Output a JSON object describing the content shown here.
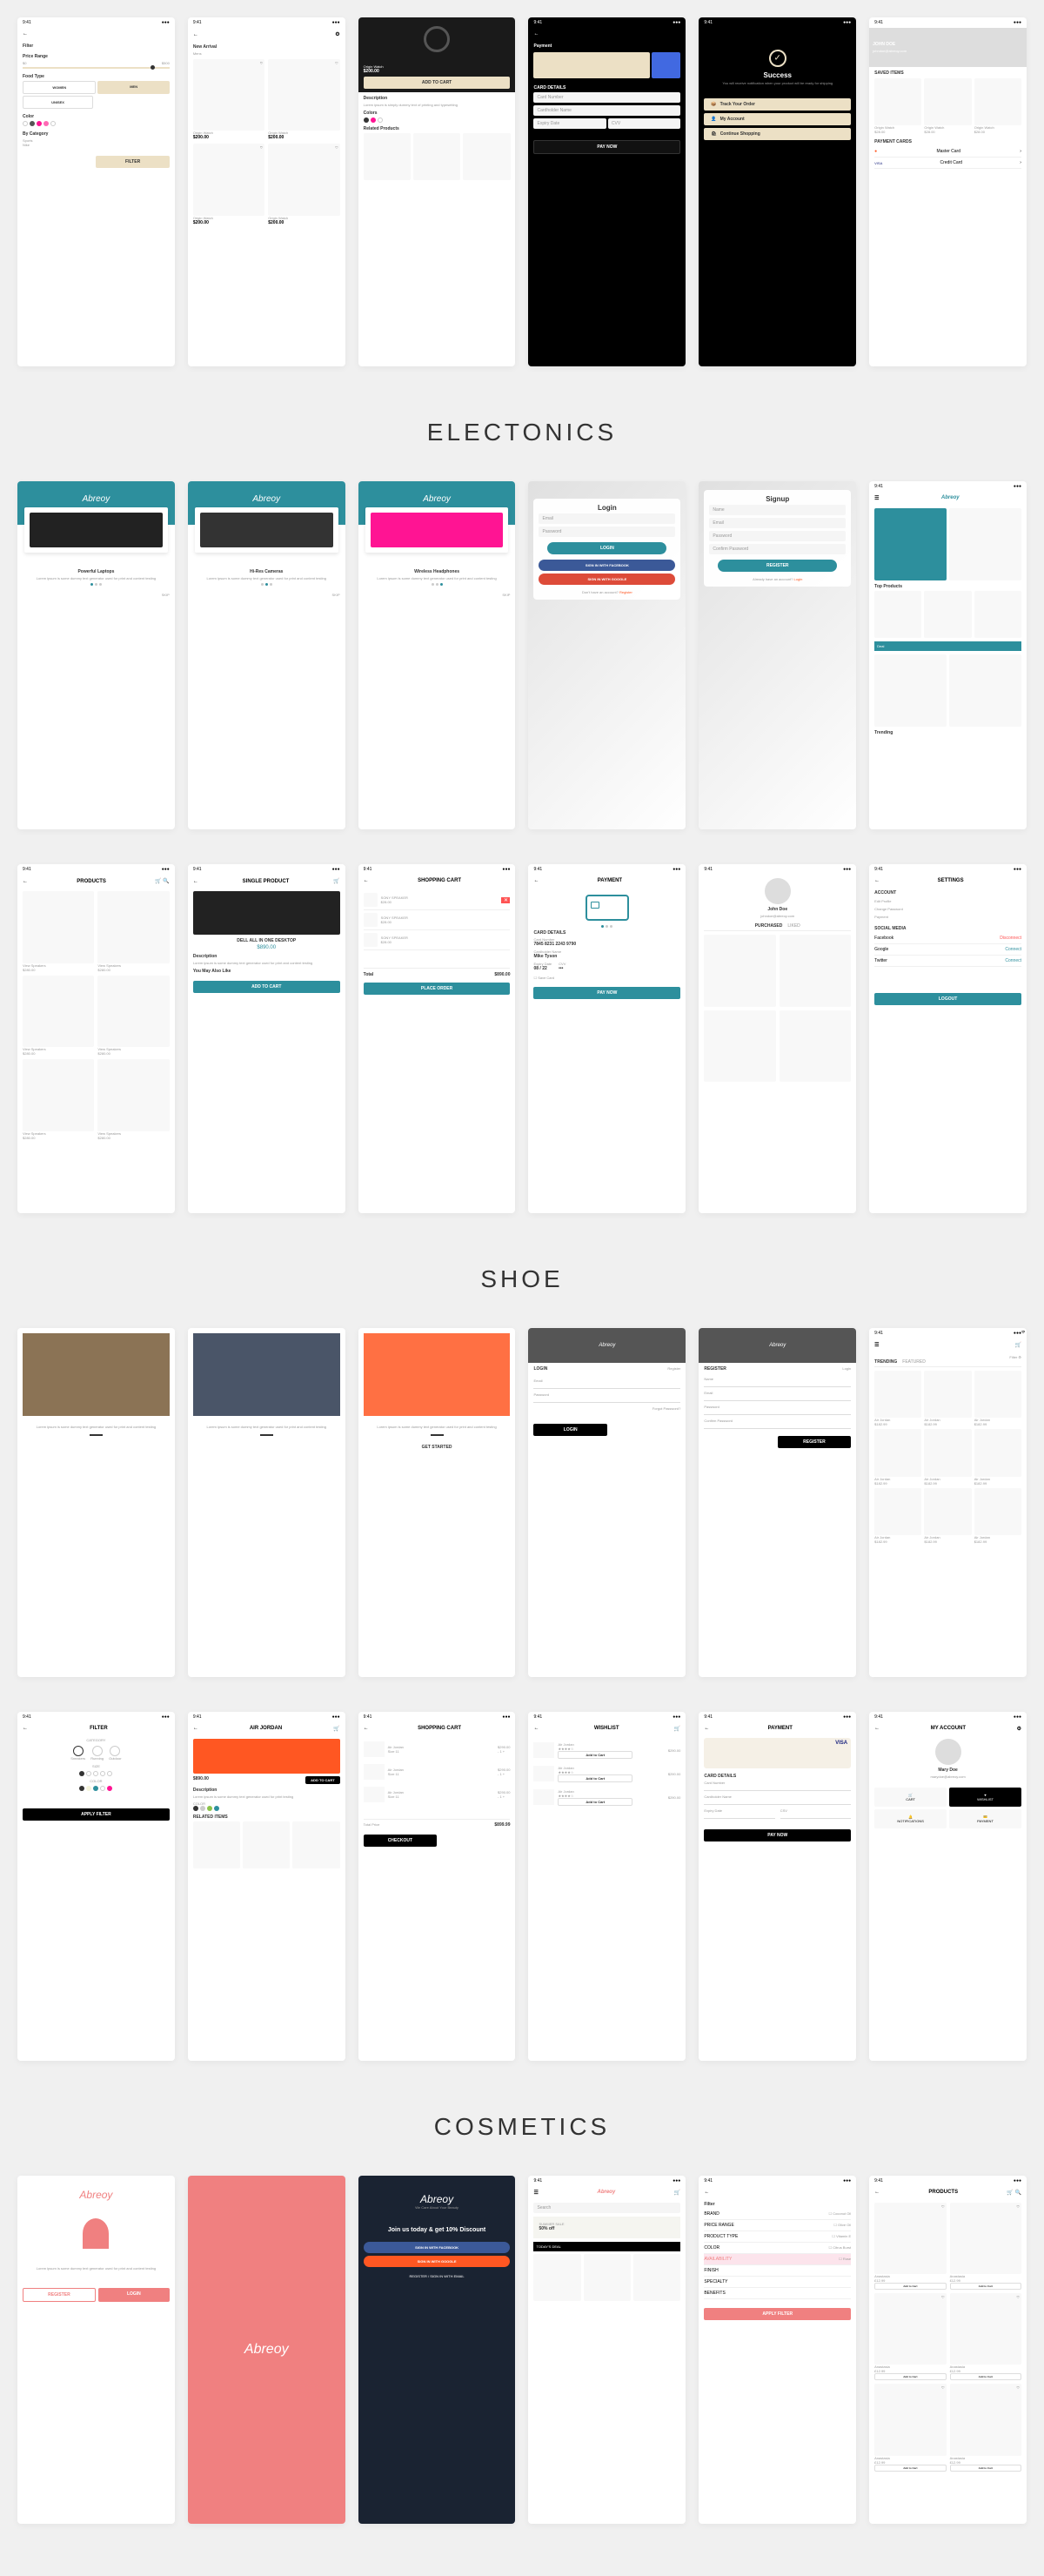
{
  "sections": {
    "electronics": "ELECTONICS",
    "shoe": "SHOE",
    "cosmetics": "COSMETICS"
  },
  "brand": "Abreoy",
  "status_time": "9:41",
  "watch": {
    "filter_title": "Filter",
    "price_range_label": "Price Range",
    "price_min": "$0",
    "price_max": "$500",
    "food_type_label": "Food Type",
    "food_types": [
      "WOMEN",
      "MEN",
      "UNISEX"
    ],
    "color_label": "Color",
    "category_label": "By Category",
    "category_options": [
      "Sports",
      "Nike"
    ],
    "filter_btn": "FILTER",
    "new_arrival": "New Arrival",
    "mens_tab": "Mens",
    "product_name": "Origin Watch",
    "product_price": "$200.00",
    "add_to_cart": "ADD TO CART",
    "description_label": "Description",
    "description_text": "Lorem ipsum is simply dummy text of printing and typesetting",
    "colors_label": "Colors",
    "related_label": "Related Products",
    "payment_title": "Payment",
    "card_details": "CARD DETAILS",
    "card_number": "Card Number",
    "cardholder": "Cardholder Name",
    "expiry": "Expiry Date",
    "cvv": "CVV",
    "pay_now": "PAY NOW",
    "success_title": "Success",
    "success_msg": "You will receive notification when your product will be ready for shipping",
    "track_order": "Track Your Order",
    "my_account": "My Account",
    "continue_shopping": "Continue Shopping",
    "profile_name": "JOHN DOE",
    "profile_email": "johndoe@abreoy.com",
    "saved_items": "SAVED ITEMS",
    "payment_cards": "PAYMENT CARDS",
    "mastercard": "Master Card",
    "credit_card": "Credit Card",
    "watch_price_sm": "$28.00"
  },
  "electronics": {
    "onboard_titles": [
      "Powerful Laptops",
      "Hi-Res Cameras",
      "Wireless Headphones"
    ],
    "onboard_desc": "Lorem ipsum is some dummy text generator used for print and content testing",
    "skip": "SKIP",
    "login": "Login",
    "signup": "Signup",
    "email": "Email",
    "password": "Password",
    "name": "Name",
    "confirm_password": "Confirm Password",
    "login_btn": "LOGIN",
    "register_btn": "REGISTER",
    "fb_btn": "SIGN IN WITH FACEBOOK",
    "google_btn": "SIGN IN WITH GOOGLE",
    "no_account": "Don't have an account?",
    "already_account": "Already have an account?",
    "register_link": "Register",
    "login_link": "Login",
    "top_products": "Top Products",
    "trending": "Trending",
    "products_title": "PRODUCTS",
    "single_product": "SINGLE PRODUCT",
    "dell_name": "DELL ALL IN ONE DESKTOP",
    "dell_price": "$890.00",
    "may_also_like": "You May Also Like",
    "shopping_cart": "SHOPPING CART",
    "cart_item": "SONY SPEAKER",
    "cart_price": "$28.00",
    "total": "Total",
    "total_price": "$890.00",
    "place_order": "PLACE ORDER",
    "payment_title": "PAYMENT",
    "card_num_val": "7845 8231 2243 9790",
    "cardholder_val": "Mike Tyson",
    "expiry_val": "08 / 22",
    "save_card": "Save Card",
    "pay_now": "PAY NOW",
    "profile_name": "John Doe",
    "profile_email": "johndoe@abreoy.com",
    "purchased": "PURCHASED",
    "liked": "LIKED",
    "settings": "SETTINGS",
    "account": "ACCOUNT",
    "edit_profile": "Edit Profile",
    "change_password": "Change Password",
    "payment_opt": "Payment",
    "social_media": "SOCIAL MEDIA",
    "facebook": "Facebook",
    "google": "Google",
    "twitter": "Twitter",
    "disconnect": "Disconnect",
    "connect": "Connect",
    "logout": "LOGOUT",
    "prod_label": "View Speakers",
    "prod_price": "$280.00"
  },
  "shoe": {
    "onboard_desc": "Lorem ipsum is some dummy text generator used for print and content testing",
    "get_started": "GET STARTED",
    "login": "LOGIN",
    "register": "REGISTER",
    "register_link": "Register",
    "login_link": "Login",
    "email": "Email",
    "password": "Password",
    "name": "Name",
    "confirm_password": "Confirm Password",
    "forgot": "Forgot Password?",
    "filter_link": "Filter",
    "trending_tab": "TRENDING",
    "featured_tab": "FEATURED",
    "shoe_name": "Air Jordan",
    "shoe_price": "$182.99",
    "filter_title": "FILTER",
    "category": "CATEGORY",
    "categories": [
      "Sneakers",
      "Running",
      "Outdoor"
    ],
    "size": "SIZE",
    "color": "COLOR",
    "apply_filter": "APPLY FILTER",
    "product_title": "AIR JORDAN",
    "product_price": "$890.00",
    "add_to_cart": "ADD TO CART",
    "description": "Description",
    "desc_text": "Lorem ipsum is some dummy text generator used for print testing",
    "related": "RELATED ITEMS",
    "cart_title": "SHOPPING CART",
    "cart_item_name": "Air Jordan",
    "cart_item_price": "$290.00",
    "cart_item_size": "Size 11",
    "total_price_label": "Total Price",
    "total_price": "$899.99",
    "checkout": "CHECKOUT",
    "wishlist": "WISHLIST",
    "add_to_cart_sm": "Add to Cart",
    "payment": "PAYMENT",
    "visa": "VISA",
    "card_details": "CARD DETAILS",
    "card_number": "Card Number",
    "cardholder": "Cardholder Name",
    "expiry": "Expiry Date",
    "csv": "CSV",
    "pay_now": "PAY NOW",
    "my_account": "MY ACCOUNT",
    "account_name": "Mary Doe",
    "account_email": "marydoe@abreoy.com",
    "cart_opt": "CART",
    "wishlist_opt": "WISHLIST",
    "notifications": "NOTIFICATIONS",
    "payment_opt": "PAYMENT"
  },
  "cosmetics": {
    "onboard_desc": "Lorem ipsum is some dummy text generator used for print and content testing",
    "register": "REGISTER",
    "login": "LOGIN",
    "tagline": "We Care About Your Beauty",
    "join_title": "Join us today & get 10% Discount",
    "fb_btn": "SIGN IN WITH FACEBOOK",
    "google_btn": "SIGN IN WITH GOOGLE",
    "register_email": "REGISTER / SIGN IN WITH EMAIL",
    "search": "Search",
    "summer_sale": "SUMMER SALE",
    "sale_pct": "50% off",
    "todays_deal": "TODAY'S DEAL",
    "filter": "Filter",
    "brand": "BRAND",
    "price_range": "PRICE RANGE",
    "product_type": "PRODUCT TYPE",
    "color": "COLOR",
    "availability": "AVAILABILITY",
    "finish": "FINISH",
    "specialty": "SPECIALTY",
    "benefits": "BENEFITS",
    "filter_opts": [
      "Coconut Oil",
      "Olive Oil",
      "Vitamin E",
      "Citrus Burst",
      "Rose"
    ],
    "apply_filter": "APPLY FILTER",
    "products_title": "PRODUCTS",
    "prod_name": "Anastasia",
    "prod_price": "£12.99",
    "add_to_cart": "Add to Cart"
  }
}
